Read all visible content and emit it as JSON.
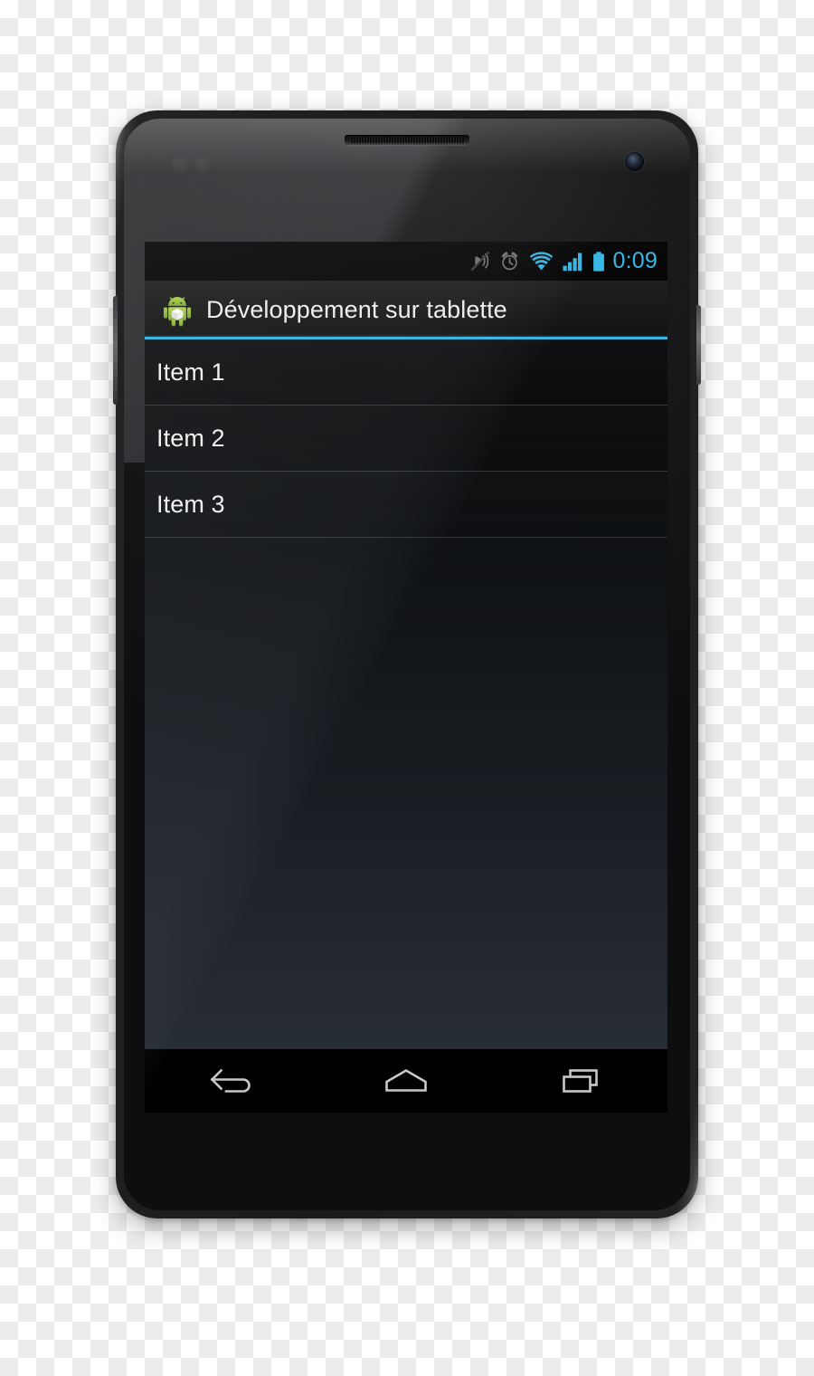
{
  "device": {
    "name": "android-smartphone",
    "hardware": {
      "earpiece": "earpiece-speaker",
      "front_camera": "front-camera",
      "sensors": "proximity-light-sensors",
      "power_button": "power-button",
      "volume_button": "volume-rocker"
    }
  },
  "status_bar": {
    "icons": [
      {
        "name": "vibrate-off-icon",
        "label": "Silencieux",
        "color": "#6e6e6e"
      },
      {
        "name": "alarm-clock-icon",
        "label": "Alarme",
        "color": "#6e6e6e"
      },
      {
        "name": "wifi-icon",
        "label": "Wi-Fi",
        "color": "#33b5e5"
      },
      {
        "name": "signal-bars-icon",
        "label": "Signal",
        "color": "#33b5e5"
      },
      {
        "name": "battery-icon",
        "label": "Batterie",
        "color": "#33b5e5"
      }
    ],
    "clock": "0:09",
    "clock_color": "#33b5e5",
    "background": "#000000"
  },
  "action_bar": {
    "icon_name": "android-robot-icon",
    "title": "Développement sur tablette",
    "accent_color": "#33b5e5"
  },
  "list": {
    "items": [
      {
        "label": "Item 1"
      },
      {
        "label": "Item 2"
      },
      {
        "label": "Item 3"
      }
    ]
  },
  "nav_bar": {
    "buttons": [
      {
        "name": "back-button",
        "label": "Retour"
      },
      {
        "name": "home-button",
        "label": "Accueil"
      },
      {
        "name": "recents-button",
        "label": "Applications récentes"
      }
    ],
    "background": "#000000"
  },
  "theme": {
    "accent": "#33b5e5",
    "text_primary": "#f5f5f5",
    "divider": "#33383d",
    "screen_background": "#000000"
  }
}
